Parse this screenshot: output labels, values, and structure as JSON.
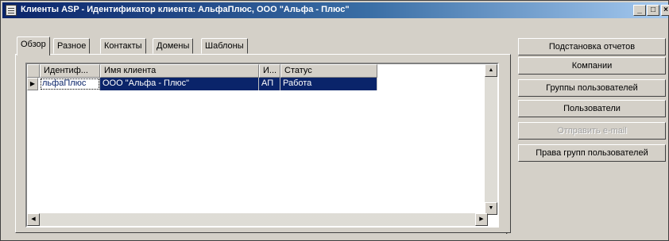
{
  "window": {
    "title": "Клиенты ASP - Идентификатор клиента: АльфаПлюс, ООО \"Альфа - Плюс\"",
    "minimize_glyph": "_",
    "maximize_glyph": "□",
    "close_glyph": "×"
  },
  "tabs": [
    {
      "label": "Обзор",
      "active": true
    },
    {
      "label": "Разное",
      "active": false
    },
    {
      "label": "Контакты",
      "active": false
    },
    {
      "label": "Домены",
      "active": false
    },
    {
      "label": "Шаблоны",
      "active": false
    }
  ],
  "grid": {
    "columns": [
      "Идентиф...",
      "Имя клиента",
      "И...",
      "Статус"
    ],
    "rows": [
      {
        "id": "льфаПлюс",
        "name": "ООО \"Альфа - Плюс\"",
        "code": "АП",
        "status": "Работа",
        "selected": true
      }
    ],
    "row_indicator": "▶"
  },
  "scroll": {
    "up": "▲",
    "down": "▼",
    "left": "◀",
    "right": "▶"
  },
  "buttons": [
    {
      "label": "Подстановка отчетов",
      "enabled": true
    },
    {
      "label": "Компании",
      "enabled": true
    },
    {
      "label": "Группы пользователей",
      "enabled": true
    },
    {
      "label": "Пользователи",
      "enabled": true
    },
    {
      "label": "Отправить e-mail",
      "enabled": false
    },
    {
      "label": "Права групп пользователей",
      "enabled": true
    }
  ],
  "colors": {
    "title_start": "#0a246a",
    "selection": "#0a246a",
    "face": "#d4d0c8"
  }
}
